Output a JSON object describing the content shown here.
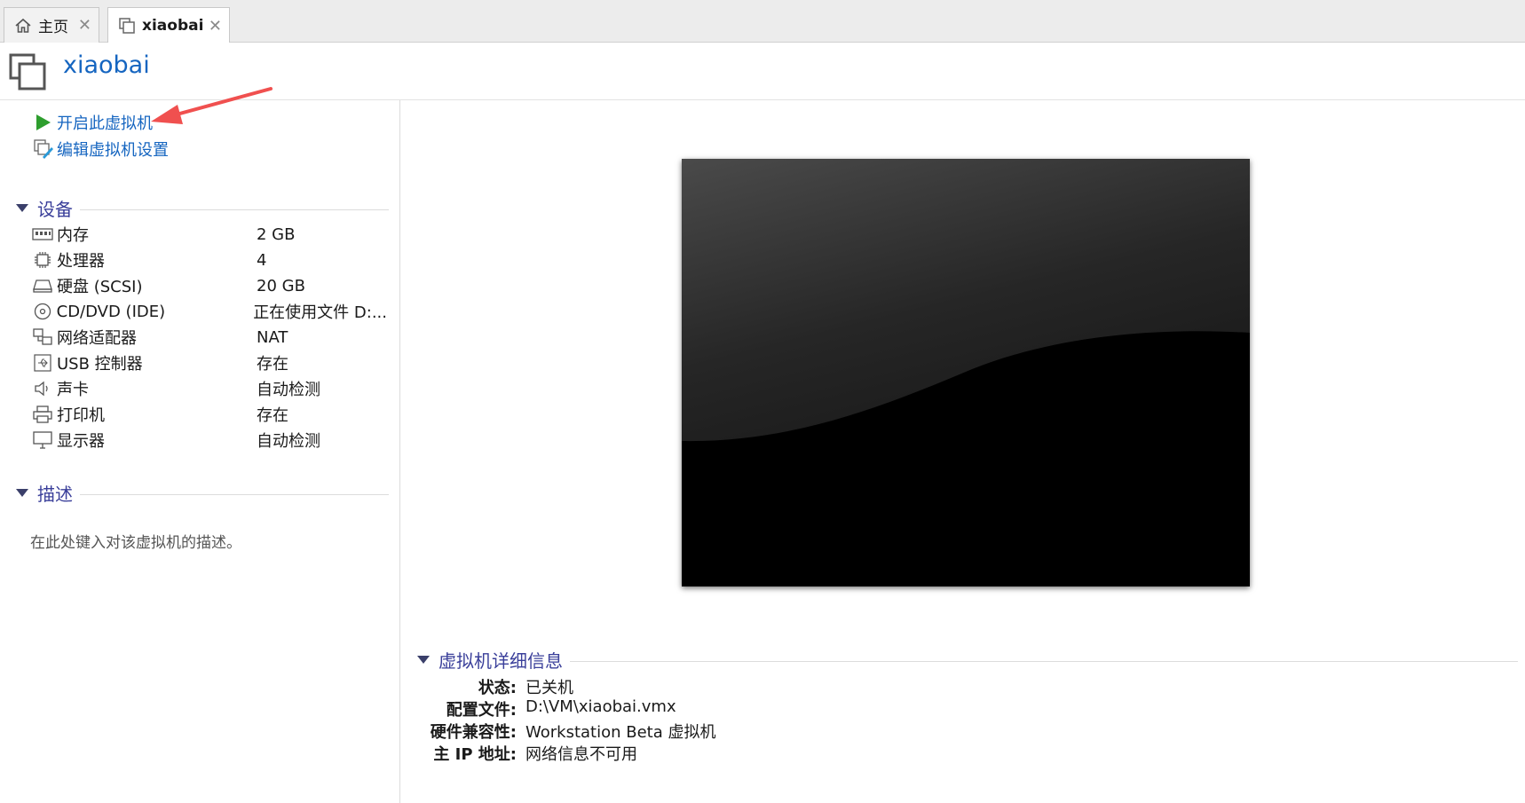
{
  "tabs": [
    {
      "label": "主页",
      "icon": "home-icon"
    },
    {
      "label": "xiaobai",
      "icon": "vm-icon"
    }
  ],
  "header": {
    "title": "xiaobai"
  },
  "actions": {
    "power_on": "开启此虚拟机",
    "edit_settings": "编辑虚拟机设置"
  },
  "devices_section": {
    "title": "设备",
    "items": [
      {
        "name": "内存",
        "value": "2 GB",
        "icon": "memory-icon"
      },
      {
        "name": "处理器",
        "value": "4",
        "icon": "cpu-icon"
      },
      {
        "name": "硬盘 (SCSI)",
        "value": "20 GB",
        "icon": "harddisk-icon"
      },
      {
        "name": "CD/DVD (IDE)",
        "value": "正在使用文件 D:...",
        "icon": "cd-icon"
      },
      {
        "name": "网络适配器",
        "value": "NAT",
        "icon": "network-icon"
      },
      {
        "name": "USB 控制器",
        "value": "存在",
        "icon": "usb-icon"
      },
      {
        "name": "声卡",
        "value": "自动检测",
        "icon": "speaker-icon"
      },
      {
        "name": "打印机",
        "value": "存在",
        "icon": "printer-icon"
      },
      {
        "name": "显示器",
        "value": "自动检测",
        "icon": "monitor-icon"
      }
    ]
  },
  "description_section": {
    "title": "描述",
    "placeholder": "在此处键入对该虚拟机的描述。"
  },
  "details_section": {
    "title": "虚拟机详细信息",
    "rows": [
      {
        "key": "状态:",
        "value": "已关机"
      },
      {
        "key": "配置文件:",
        "value": "D:\\VM\\xiaobai.vmx"
      },
      {
        "key": "硬件兼容性:",
        "value": "Workstation Beta 虚拟机"
      },
      {
        "key": "主 IP 地址:",
        "value": "网络信息不可用"
      }
    ]
  },
  "colors": {
    "link": "#1565c0",
    "section_title": "#3a3f9a",
    "play_green": "#2e9e2e",
    "annotation_arrow": "#f0504f"
  }
}
